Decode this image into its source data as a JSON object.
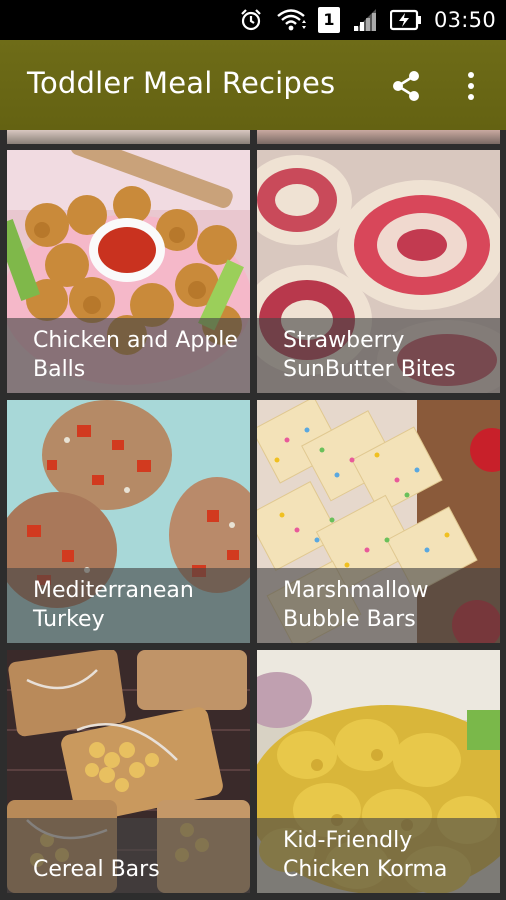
{
  "status_bar": {
    "time": "03:50",
    "sim_label": "1",
    "icons": [
      "alarm-icon",
      "wifi-icon",
      "sim-icon",
      "signal-icon",
      "battery-charging-icon"
    ]
  },
  "app_bar": {
    "title": "Toddler Meal Recipes",
    "share_icon": "share-icon",
    "menu_icon": "overflow-menu-icon",
    "color": "#6b6a1a"
  },
  "recipes": [
    {
      "title": "Chicken and Apple Balls"
    },
    {
      "title": "Strawberry SunButter Bites"
    },
    {
      "title": "Mediterranean Turkey"
    },
    {
      "title": "Marshmallow Bubble Bars"
    },
    {
      "title": "Cereal Bars"
    },
    {
      "title": "Kid-Friendly Chicken Korma"
    }
  ]
}
